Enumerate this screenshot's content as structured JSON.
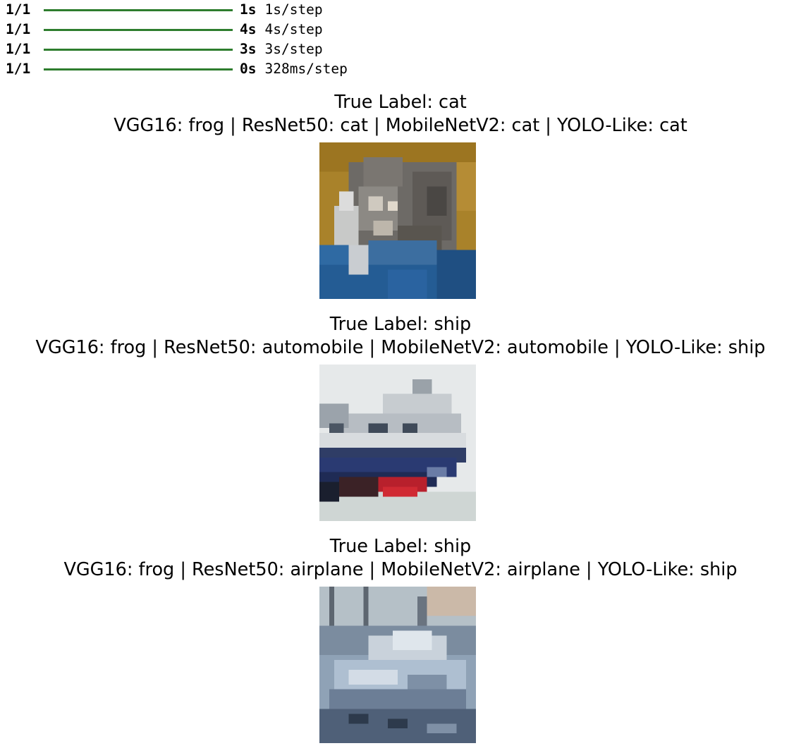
{
  "log": {
    "lines": [
      {
        "step": "1/1",
        "time": "1s",
        "per_step": "1s/step"
      },
      {
        "step": "1/1",
        "time": "4s",
        "per_step": "4s/step"
      },
      {
        "step": "1/1",
        "time": "3s",
        "per_step": "3s/step"
      },
      {
        "step": "1/1",
        "time": "0s",
        "per_step": "328ms/step"
      }
    ]
  },
  "figure": {
    "panels": [
      {
        "title_line1": "True Label: cat",
        "title_line2": "VGG16: frog | ResNet50: cat | MobileNetV2: cat | YOLO-Like: cat",
        "image": "cat-thumbnail"
      },
      {
        "title_line1": "True Label: ship",
        "title_line2": "VGG16: frog | ResNet50: automobile | MobileNetV2: automobile | YOLO-Like: ship",
        "image": "ship-thumbnail"
      },
      {
        "title_line1": "True Label: ship",
        "title_line2": "VGG16: frog | ResNet50: airplane | MobileNetV2: airplane | YOLO-Like: ship",
        "image": "ship-thumbnail"
      }
    ]
  },
  "colors": {
    "progress_bar": "#2e7d2e"
  }
}
